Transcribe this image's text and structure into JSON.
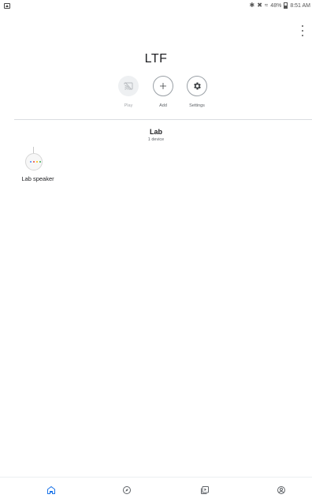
{
  "status_bar": {
    "battery_text": "48%",
    "time": "8:51 AM",
    "icons": [
      "bluetooth-icon",
      "mute-icon",
      "wifi-icon",
      "battery-icon"
    ]
  },
  "header": {
    "title": "LTF"
  },
  "actions": [
    {
      "label": "Play",
      "icon": "cast-icon",
      "enabled": false
    },
    {
      "label": "Add",
      "icon": "plus-icon",
      "enabled": true
    },
    {
      "label": "Settings",
      "icon": "gear-icon",
      "enabled": true
    }
  ],
  "room": {
    "name": "Lab",
    "device_count": "1 device",
    "devices": [
      {
        "name": "Lab speaker",
        "icon": "google-home-mini-icon",
        "dot_colors": [
          "#4285f4",
          "#ea4335",
          "#fbbc04",
          "#34a853"
        ]
      }
    ]
  },
  "bottom_nav": {
    "items": [
      {
        "name": "home",
        "icon": "home-icon",
        "active": true
      },
      {
        "name": "discover",
        "icon": "compass-icon",
        "active": false
      },
      {
        "name": "media",
        "icon": "media-icon",
        "active": false
      },
      {
        "name": "account",
        "icon": "account-icon",
        "active": false
      }
    ]
  },
  "colors": {
    "accent": "#1a73e8",
    "icon_gray": "#5f6368"
  }
}
